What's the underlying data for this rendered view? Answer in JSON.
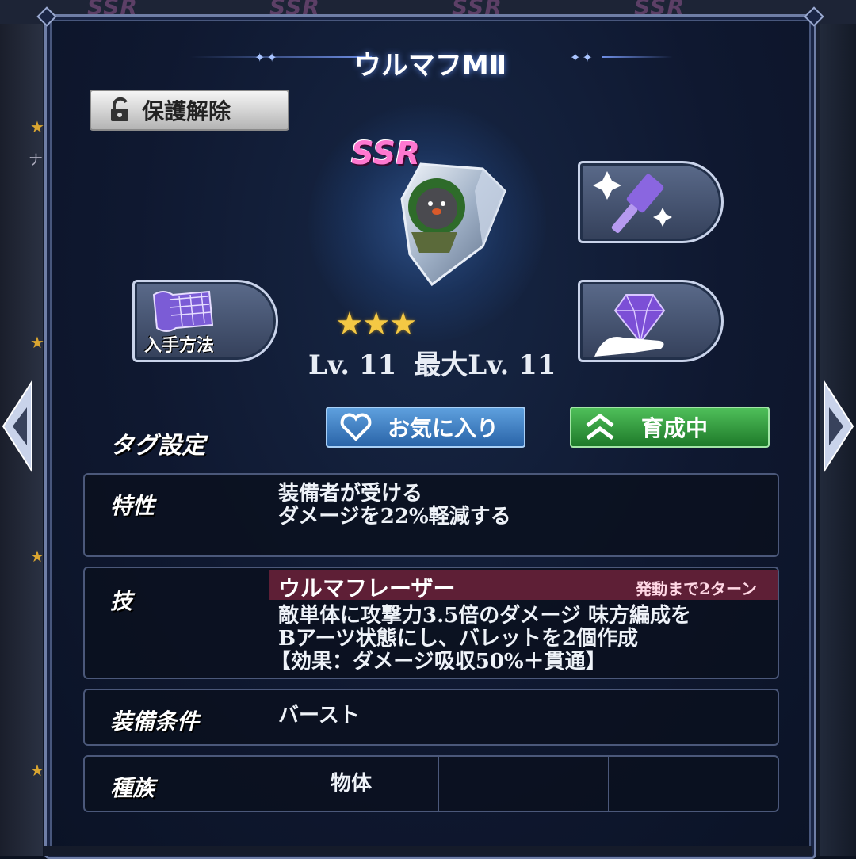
{
  "background": {
    "strip_labels": [
      "SSR",
      "SSR",
      "SSR",
      "SSR"
    ],
    "side_fragment": "ナ"
  },
  "modal": {
    "title": "ウルマフMⅡ"
  },
  "protect_button": {
    "label": "保護解除",
    "icon": "unlock-icon"
  },
  "equipment": {
    "rarity": "SSR",
    "stars": 3,
    "stars_text": "★★★",
    "level": "Lv. 11",
    "max_level": "最大Lv. 11",
    "art_icon": "shield-mole-icon"
  },
  "side_buttons": {
    "acquire_label": "入手方法",
    "acquire_icon": "map-icon",
    "upgrade_icon": "hammer-sparkle-icon",
    "material_icon": "gem-hand-icon"
  },
  "tags": {
    "label": "タグ設定",
    "favorite_label": "お気に入り",
    "training_label": "育成中"
  },
  "trait": {
    "label": "特性",
    "lines": [
      "装備者が受ける",
      "ダメージを22%軽減する"
    ]
  },
  "skill": {
    "label": "技",
    "name": "ウルマフレーザー",
    "cooldown": "発動まで2ターン",
    "lines": [
      "敵単体に攻撃力3.5倍のダメージ 味方編成を",
      "Bアーツ状態にし、バレットを2個作成",
      "【効果：ダメージ吸収50%＋貫通】"
    ]
  },
  "equip_condition": {
    "label": "装備条件",
    "value": "バースト"
  },
  "race": {
    "label": "種族",
    "values": [
      "物体",
      "",
      ""
    ]
  },
  "colors": {
    "favorite": "#2a64a8",
    "training": "#1e7a2a",
    "skill_header": "#5e1f36",
    "rarity": "#ff78d0",
    "star": "#f4c844"
  }
}
